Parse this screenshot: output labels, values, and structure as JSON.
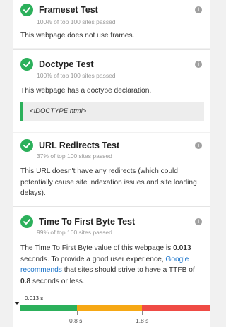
{
  "cards": [
    {
      "title": "Frameset Test",
      "subtitle": "100% of top 100 sites passed",
      "description": "This webpage does not use frames."
    },
    {
      "title": "Doctype Test",
      "subtitle": "100% of top 100 sites passed",
      "description": "This webpage has a doctype declaration.",
      "code": "<!DOCTYPE html>"
    },
    {
      "title": "URL Redirects Test",
      "subtitle": "37% of top 100 sites passed",
      "description": "This URL doesn't have any redirects (which could potentially cause site indexation issues and site loading delays)."
    },
    {
      "title": "Time To First Byte Test",
      "subtitle": "99% of top 100 sites passed",
      "desc_part1": "The Time To First Byte value of this webpage is ",
      "desc_value": "0.013",
      "desc_part2": " seconds. To provide a good user experience, ",
      "desc_link": "Google recommends",
      "desc_part3": " that sites should strive to have a TTFB of ",
      "desc_value2": "0.8",
      "desc_part4": " seconds or less."
    }
  ],
  "info_icon": "i",
  "ttfb_scale": {
    "marker_label": "0.013 s",
    "marker_value": 0.013,
    "ticks": [
      "0.8 s",
      "1.8 s"
    ],
    "segments": [
      {
        "name": "good",
        "color": "#2cb05b"
      },
      {
        "name": "needs-improvement",
        "color": "#f6a814"
      },
      {
        "name": "poor",
        "color": "#ef4b45"
      }
    ]
  },
  "colors": {
    "pass": "#2cb05b",
    "link": "#1a73c9"
  }
}
